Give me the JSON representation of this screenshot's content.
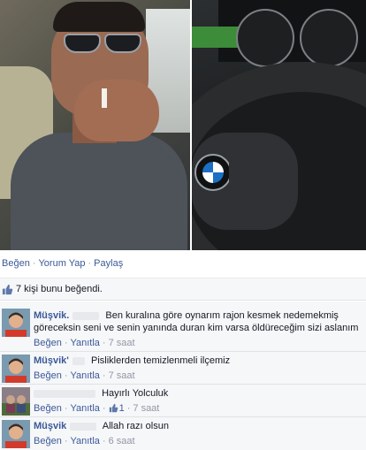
{
  "actions": {
    "like": "Beğen",
    "comment": "Yorum Yap",
    "share": "Paylaş",
    "separator": "·"
  },
  "likes_summary": "7 kişi bunu beğendi.",
  "comments": [
    {
      "name": "Müşvik",
      "name_dot": ".",
      "text": "Ben kuralına göre oynarım rajon kesmek nedemekmiş göreceksin seni ve senin yanında duran kim varsa öldüreceğim sizi aslanım",
      "like": "Beğen",
      "reply": "Yanıtla",
      "time": "7 saat"
    },
    {
      "name": "Müşvik",
      "name_dot": "'",
      "text": "Pisliklerden temizlenmeli ilçemiz",
      "like": "Beğen",
      "reply": "Yanıtla",
      "time": "7 saat"
    },
    {
      "name": "",
      "name_dot": "",
      "text": "Hayırlı Yolculuk",
      "like": "Beğen",
      "reply": "Yanıtla",
      "like_count": "1",
      "time": "7 saat"
    },
    {
      "name": "Müşvik",
      "name_dot": "",
      "text": "Allah razı olsun",
      "like": "Beğen",
      "reply": "Yanıtla",
      "time": "6 saat"
    }
  ],
  "colors": {
    "link": "#3b5998",
    "meta": "#9197a3",
    "panel": "#f6f7f9"
  },
  "photo_logo_text": "BMW"
}
